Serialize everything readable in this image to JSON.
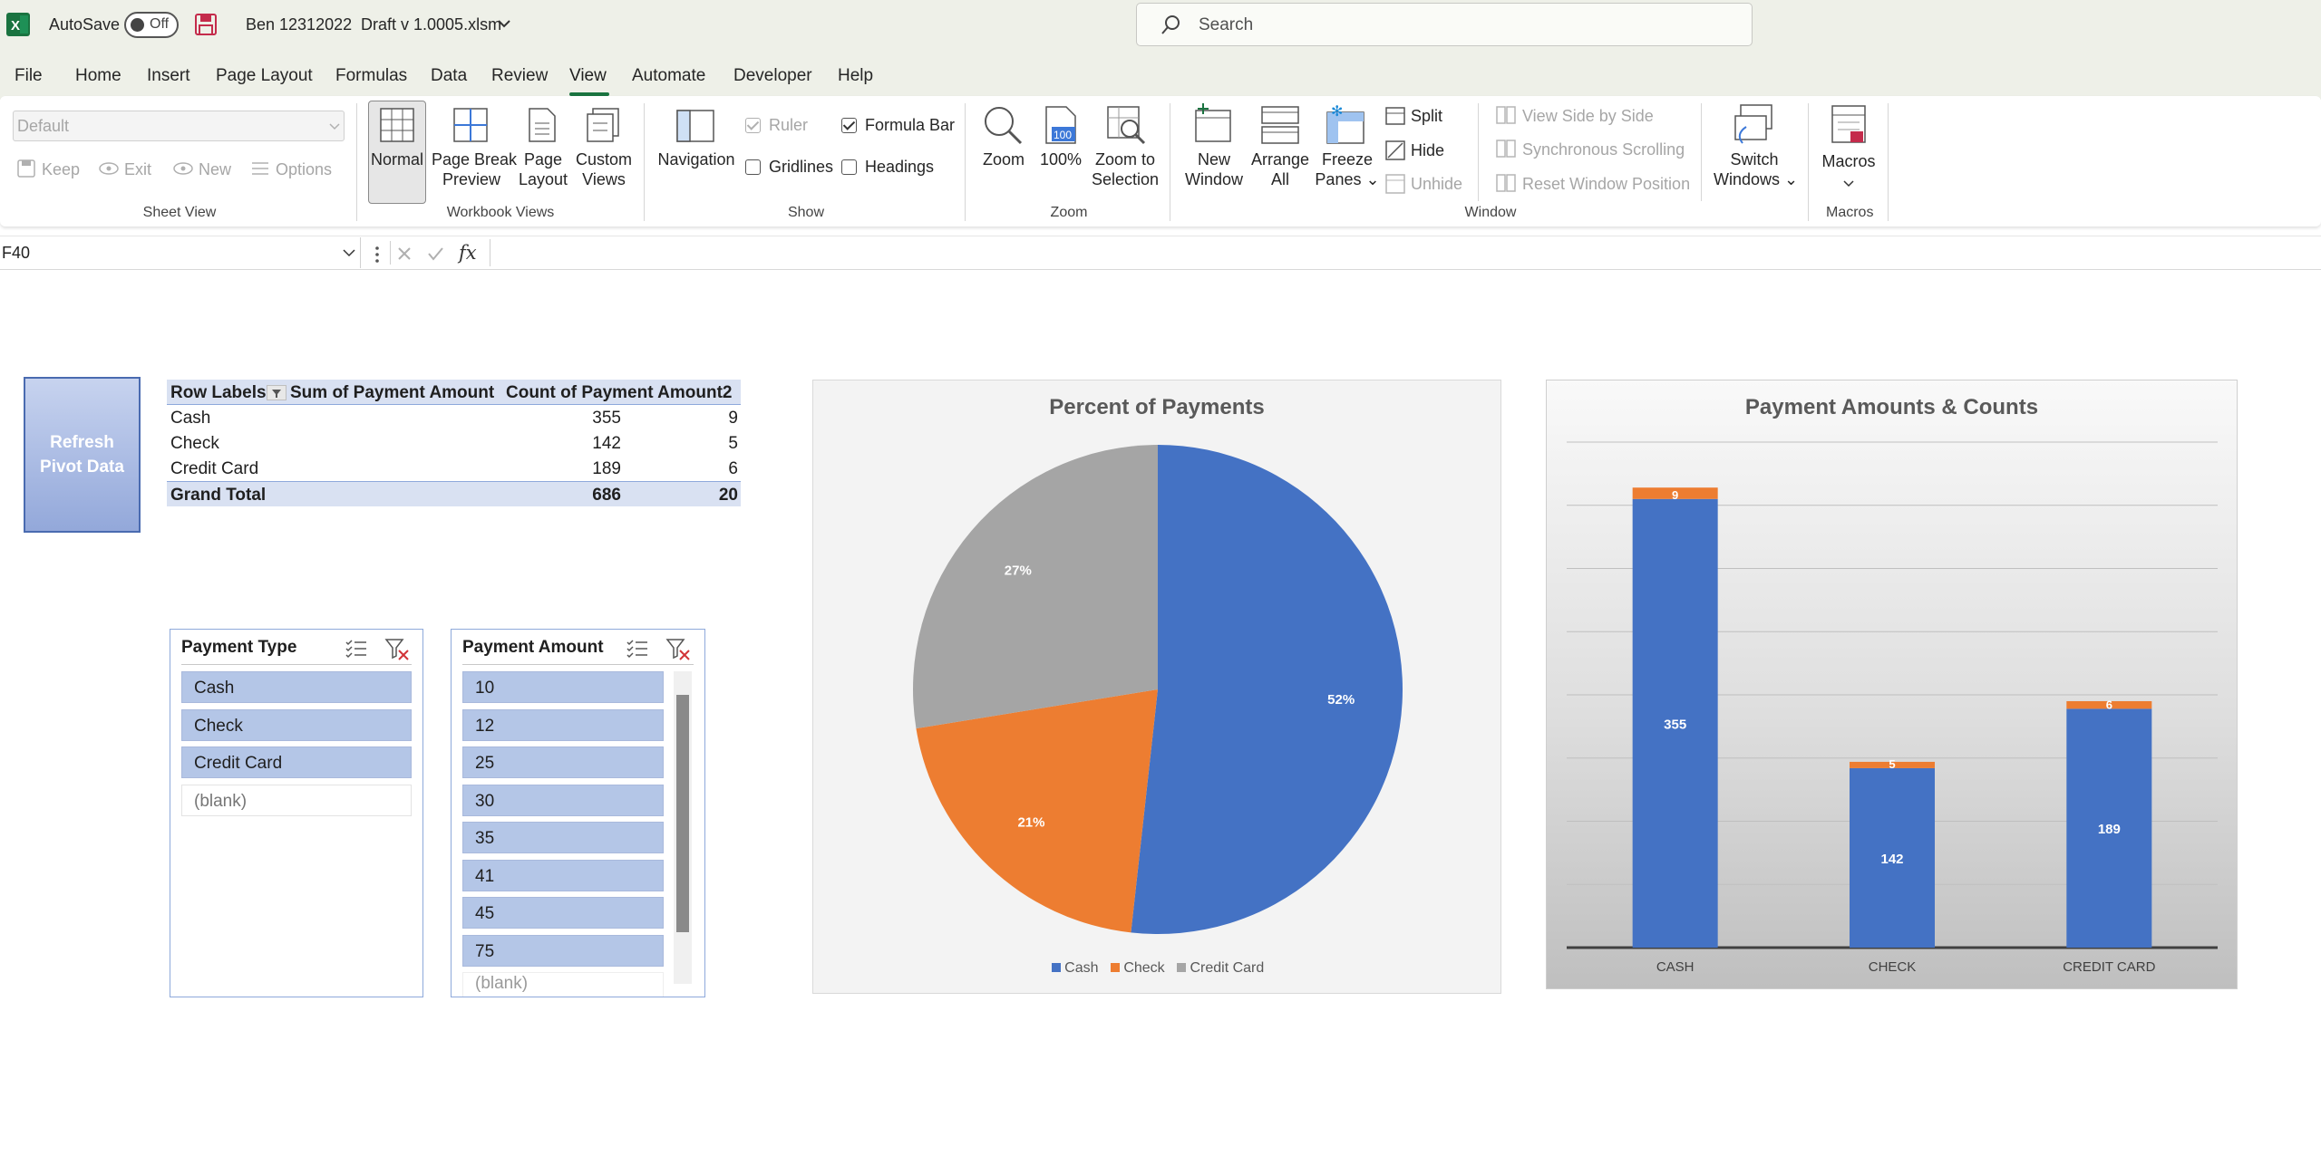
{
  "titlebar": {
    "app_icon": "excel-icon",
    "autosave_label": "AutoSave",
    "autosave_state": "Off",
    "save_icon": "save-icon",
    "user": "Ben 12312022",
    "filename": "Draft v 1.0005.xlsm",
    "search_placeholder": "Search"
  },
  "menu": [
    "File",
    "Home",
    "Insert",
    "Page Layout",
    "Formulas",
    "Data",
    "Review",
    "View",
    "Automate",
    "Developer",
    "Help"
  ],
  "active_menu": "View",
  "ribbon": {
    "sheet_view": {
      "dropdown_value": "Default",
      "keep": "Keep",
      "exit": "Exit",
      "new": "New",
      "options": "Options",
      "group_label": "Sheet View"
    },
    "workbook_views": {
      "normal": "Normal",
      "page_break_1": "Page Break",
      "page_break_2": "Preview",
      "page_layout_1": "Page",
      "page_layout_2": "Layout",
      "custom_views_1": "Custom",
      "custom_views_2": "Views",
      "group_label": "Workbook Views"
    },
    "show": {
      "navigation": "Navigation",
      "ruler": "Ruler",
      "formula_bar": "Formula Bar",
      "gridlines": "Gridlines",
      "headings": "Headings",
      "group_label": "Show"
    },
    "zoom": {
      "zoom": "Zoom",
      "hundred": "100%",
      "hundred_icon_text": "100",
      "zoom_sel_1": "Zoom to",
      "zoom_sel_2": "Selection",
      "group_label": "Zoom"
    },
    "window": {
      "new_window_1": "New",
      "new_window_2": "Window",
      "arrange_1": "Arrange",
      "arrange_2": "All",
      "freeze_1": "Freeze",
      "freeze_2": "Panes",
      "split": "Split",
      "hide": "Hide",
      "unhide": "Unhide",
      "side_by_side": "View Side by Side",
      "sync_scroll": "Synchronous Scrolling",
      "reset_pos": "Reset Window Position",
      "switch_1": "Switch",
      "switch_2": "Windows",
      "group_label": "Window"
    },
    "macros": {
      "label": "Macros",
      "group_label": "Macros"
    }
  },
  "formula_bar": {
    "cell_ref": "F40",
    "fx": "fx",
    "value": ""
  },
  "refresh_button": {
    "line1": "Refresh",
    "line2": "Pivot Data"
  },
  "pivot": {
    "headers": [
      "Row Labels",
      "Sum of Payment Amount",
      "Count of Payment Amount2"
    ],
    "rows": [
      [
        "Cash",
        "355",
        "9"
      ],
      [
        "Check",
        "142",
        "5"
      ],
      [
        "Credit Card",
        "189",
        "6"
      ]
    ],
    "total": [
      "Grand Total",
      "686",
      "20"
    ]
  },
  "slicers": {
    "payment_type": {
      "title": "Payment Type",
      "items": [
        "Cash",
        "Check",
        "Credit Card"
      ],
      "empty_item": "(blank)"
    },
    "payment_amount": {
      "title": "Payment Amount",
      "items": [
        "10",
        "12",
        "25",
        "30",
        "35",
        "41",
        "45",
        "75"
      ],
      "partial_item": "(blank)"
    }
  },
  "colors": {
    "cash": "#4472c4",
    "check": "#ed7d31",
    "credit_card": "#a5a5a5",
    "excel_green": "#1a7340"
  },
  "chart_data": [
    {
      "type": "pie",
      "title": "Percent of Payments",
      "categories": [
        "Cash",
        "Check",
        "Credit Card"
      ],
      "values": [
        355,
        142,
        189
      ],
      "data_labels": [
        "52%",
        "21%",
        "27%"
      ],
      "legend": "bottom"
    },
    {
      "type": "bar",
      "stacked": true,
      "title": "Payment Amounts & Counts",
      "categories": [
        "CASH",
        "CHECK",
        "CREDIT CARD"
      ],
      "series": [
        {
          "values": [
            355,
            142,
            189
          ]
        },
        {
          "values": [
            9,
            5,
            6
          ]
        }
      ],
      "ylim": [
        0,
        400
      ],
      "grid": true,
      "legend": "none"
    }
  ]
}
